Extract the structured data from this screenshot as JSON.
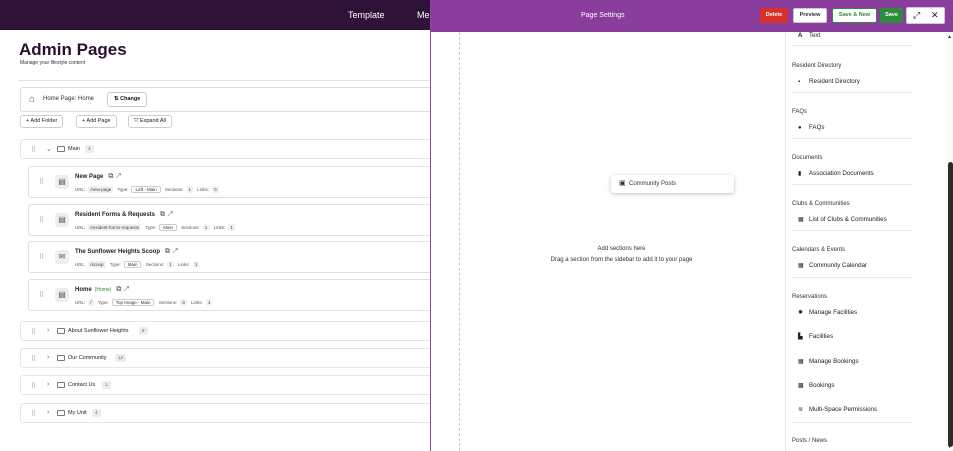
{
  "topbar": {
    "nav": [
      "Template",
      "Me"
    ]
  },
  "admin": {
    "title": "Admin Pages",
    "subtitle": "Manage your lifestyle content",
    "home_page_text": "Home Page: Home",
    "change_label": "Change",
    "toolbar": {
      "add_folder": "+ Add Folder",
      "add_page": "+ Add Page",
      "expand_all": "Expand All"
    },
    "sections": [
      {
        "name": "Main",
        "count": "4",
        "expanded": true
      },
      {
        "name": "About Sunflower Heights",
        "count": "8",
        "expanded": false
      },
      {
        "name": "Our Community",
        "count": "12",
        "expanded": false
      },
      {
        "name": "Contact Us",
        "count": "1",
        "expanded": false
      },
      {
        "name": "My Unit",
        "count": "4",
        "expanded": false
      }
    ],
    "meta_labels": {
      "url": "URL:",
      "type": "Type:",
      "sections": "Sections:",
      "links": "Links:"
    },
    "pages": [
      {
        "title": "New Page",
        "home_tag": "",
        "url": "/new-page",
        "type": "Left - Main",
        "sections": "1",
        "links": "0"
      },
      {
        "title": "Resident Forms & Requests",
        "home_tag": "",
        "url": "/resident-forms-requests",
        "type": "Main",
        "sections": "1",
        "links": "1"
      },
      {
        "title": "The Sunflower Heights Scoop",
        "home_tag": "",
        "url": "/scoop",
        "type": "Main",
        "sections": "1",
        "links": "1"
      },
      {
        "title": "Home",
        "home_tag": "(Home)",
        "url": "/",
        "type": "Top Image - Main",
        "sections": "3",
        "links": "1"
      }
    ]
  },
  "panel": {
    "title": "Page Settings",
    "buttons": {
      "delete": "Delete",
      "preview": "Preview",
      "save_new": "Save & New",
      "save": "Save"
    },
    "dragging_chip": "Community Posts",
    "placeholder_title": "Add sections here",
    "placeholder_hint": "Drag a section from the sidebar to add it to your page",
    "sidebar": {
      "top_item": "Text",
      "groups": [
        {
          "title": "Resident Directory",
          "items": [
            {
              "label": "Resident Directory",
              "icon": "contact-card-icon"
            }
          ]
        },
        {
          "title": "FAQs",
          "items": [
            {
              "label": "FAQs",
              "icon": "question-circle-icon"
            }
          ]
        },
        {
          "title": "Documents",
          "items": [
            {
              "label": "Association Documents",
              "icon": "file-icon"
            }
          ]
        },
        {
          "title": "Clubs & Communities",
          "items": [
            {
              "label": "List of Clubs & Communities",
              "icon": "calendar-icon"
            }
          ]
        },
        {
          "title": "Calendars & Events",
          "items": [
            {
              "label": "Community Calendar",
              "icon": "calendar-icon"
            }
          ]
        },
        {
          "title": "Reservations",
          "items": [
            {
              "label": "Manage Facilities",
              "icon": "gear-icon"
            },
            {
              "label": "Facilities",
              "icon": "building-icon"
            },
            {
              "label": "Manage Bookings",
              "icon": "calendar-icon"
            },
            {
              "label": "Bookings",
              "icon": "calendar-check-icon"
            },
            {
              "label": "Multi-Space Permissions",
              "icon": "layers-icon"
            }
          ]
        },
        {
          "title": "Posts / News",
          "items": []
        }
      ]
    }
  },
  "colors": {
    "topbar": "#2f1237",
    "panel_header": "#8b3d9d",
    "delete": "#d9302c",
    "save": "#2e8a3c",
    "brand_title": "#2a0f33"
  }
}
